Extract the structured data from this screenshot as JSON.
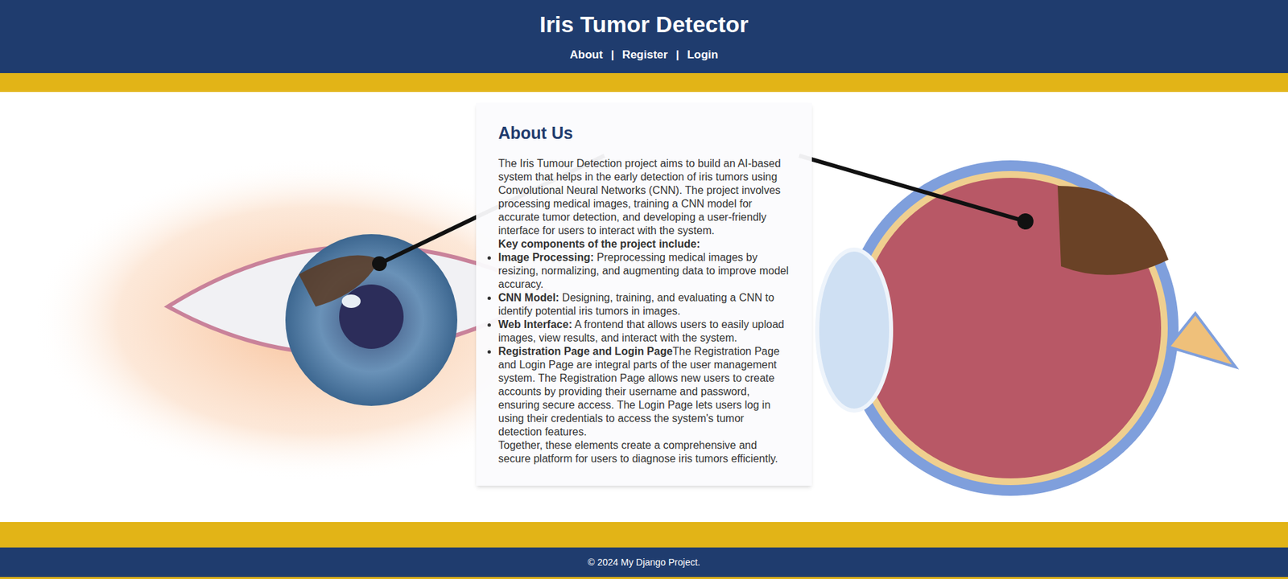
{
  "header": {
    "title": "Iris Tumor Detector",
    "nav": [
      {
        "label": "About"
      },
      {
        "label": "Register"
      },
      {
        "label": "Login"
      }
    ],
    "separator": "|"
  },
  "about": {
    "heading": "About Us",
    "intro": "The Iris Tumour Detection project aims to build an AI-based system that helps in the early detection of iris tumors using Convolutional Neural Networks (CNN). The project involves processing medical images, training a CNN model for accurate tumor detection, and developing a user-friendly interface for users to interact with the system.",
    "key_heading": "Key components of the project include:",
    "items": [
      {
        "label": "Image Processing:",
        "text": " Preprocessing medical images by resizing, normalizing, and augmenting data to improve model accuracy."
      },
      {
        "label": "CNN Model:",
        "text": " Designing, training, and evaluating a CNN to identify potential iris tumors in images."
      },
      {
        "label": "Web Interface:",
        "text": " A frontend that allows users to easily upload images, view results, and interact with the system."
      },
      {
        "label": "Registration Page and Login Page",
        "text": "The Registration Page and Login Page are integral parts of the user management system. The Registration Page allows new users to create accounts by providing their username and password, ensuring secure access. The Login Page lets users log in using their credentials to access the system's tumor detection features."
      }
    ],
    "closing": "Together, these elements create a comprehensive and secure platform for users to diagnose iris tumors efficiently."
  },
  "footer": {
    "text": "© 2024 My Django Project."
  }
}
